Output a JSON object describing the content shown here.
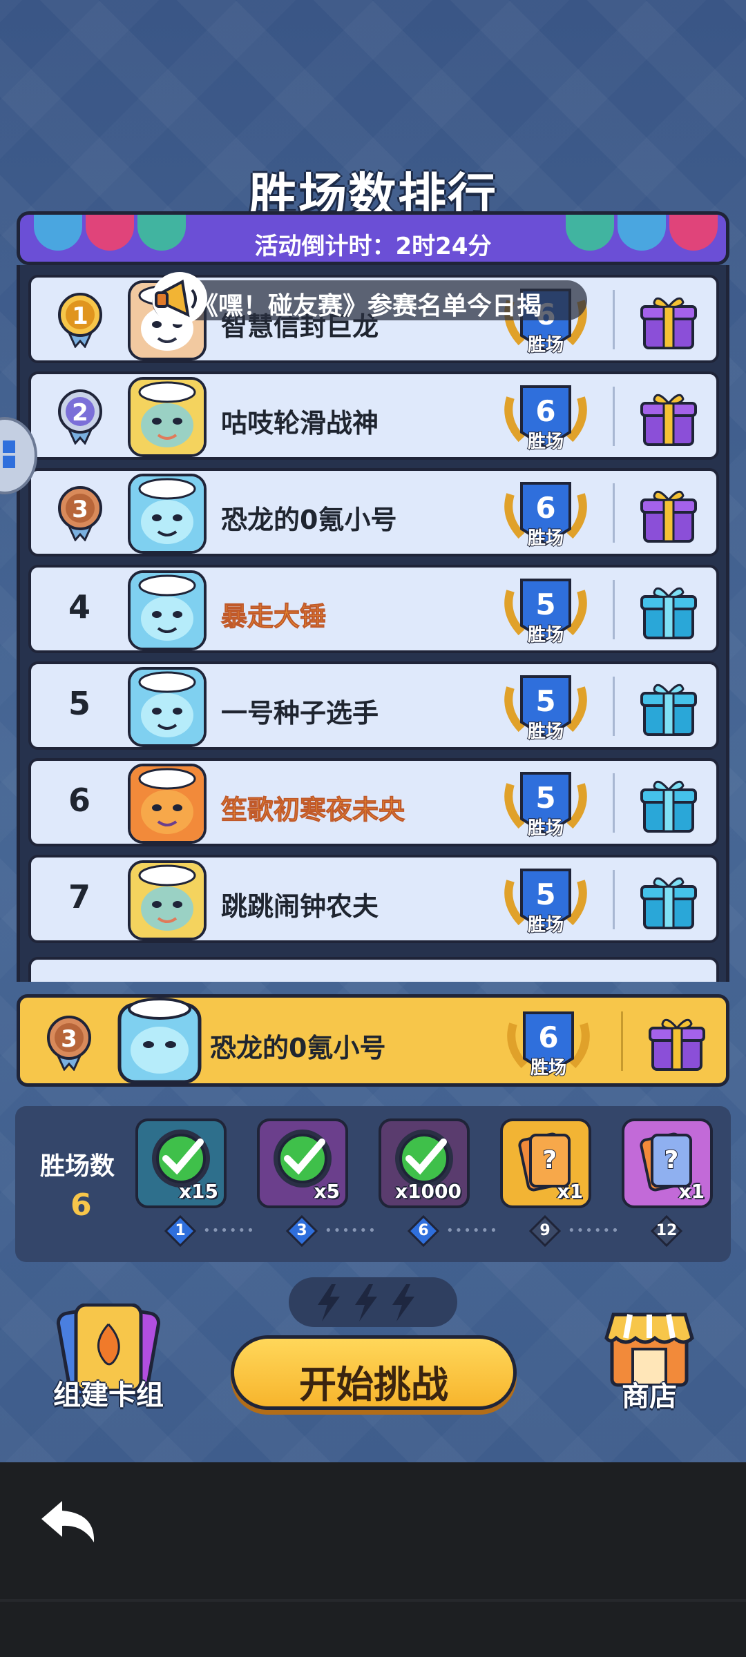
{
  "title": "胜场数排行",
  "countdown": "活动倒计时：2时24分",
  "announcement": "《嘿！碰友赛》参赛名单今日揭",
  "wins_unit": "胜场",
  "ranking": [
    {
      "rank": "1",
      "name": "智慧信封巨龙",
      "wins": "6",
      "medal": "gold",
      "avatar": "pirate",
      "name_style": "normal",
      "gift": "purple"
    },
    {
      "rank": "2",
      "name": "咕吱轮滑战神",
      "wins": "6",
      "medal": "silver",
      "avatar": "knight",
      "name_style": "normal",
      "gift": "purple"
    },
    {
      "rank": "3",
      "name": "恐龙的0氪小号",
      "wins": "6",
      "medal": "bronze",
      "avatar": "blue",
      "name_style": "normal",
      "gift": "purple"
    },
    {
      "rank": "4",
      "name": "暴走大锤",
      "wins": "5",
      "medal": "none",
      "avatar": "blue",
      "name_style": "orange",
      "gift": "blue"
    },
    {
      "rank": "5",
      "name": "一号种子选手",
      "wins": "5",
      "medal": "none",
      "avatar": "blue",
      "name_style": "normal",
      "gift": "blue"
    },
    {
      "rank": "6",
      "name": "笙歌初寒夜未央",
      "wins": "5",
      "medal": "none",
      "avatar": "pumpkin",
      "name_style": "orange",
      "gift": "blue"
    },
    {
      "rank": "7",
      "name": "跳跳闹钟农夫",
      "wins": "5",
      "medal": "none",
      "avatar": "knight",
      "name_style": "normal",
      "gift": "blue"
    }
  ],
  "my_rank": {
    "rank": "3",
    "name": "恐龙的0氪小号",
    "wins": "6",
    "medal": "bronze",
    "gift": "purple"
  },
  "progress": {
    "label": "胜场数",
    "current_wins": "6",
    "rewards": [
      {
        "qty": "x15",
        "claimed": true,
        "color": "#2e6f8c"
      },
      {
        "qty": "x5",
        "claimed": true,
        "color": "#6b3f8c"
      },
      {
        "qty": "x1000",
        "claimed": true,
        "color": "#5a3c6e"
      },
      {
        "qty": "x1",
        "claimed": false,
        "color": "#f2b434"
      },
      {
        "qty": "x1",
        "claimed": false,
        "color": "#c26ad8"
      }
    ],
    "milestones": [
      "1",
      "3",
      "6",
      "9",
      "12"
    ],
    "milestones_reached": [
      "1",
      "3",
      "6"
    ]
  },
  "buttons": {
    "deck": "组建卡组",
    "start": "开始挑战",
    "shop": "商店"
  },
  "energy_remaining": 3,
  "colors": {
    "gold": "#f7c64a",
    "banner": "#6b4fd6",
    "row_bg": "#dfe9fb",
    "win_badge": "#2f6fdc"
  }
}
